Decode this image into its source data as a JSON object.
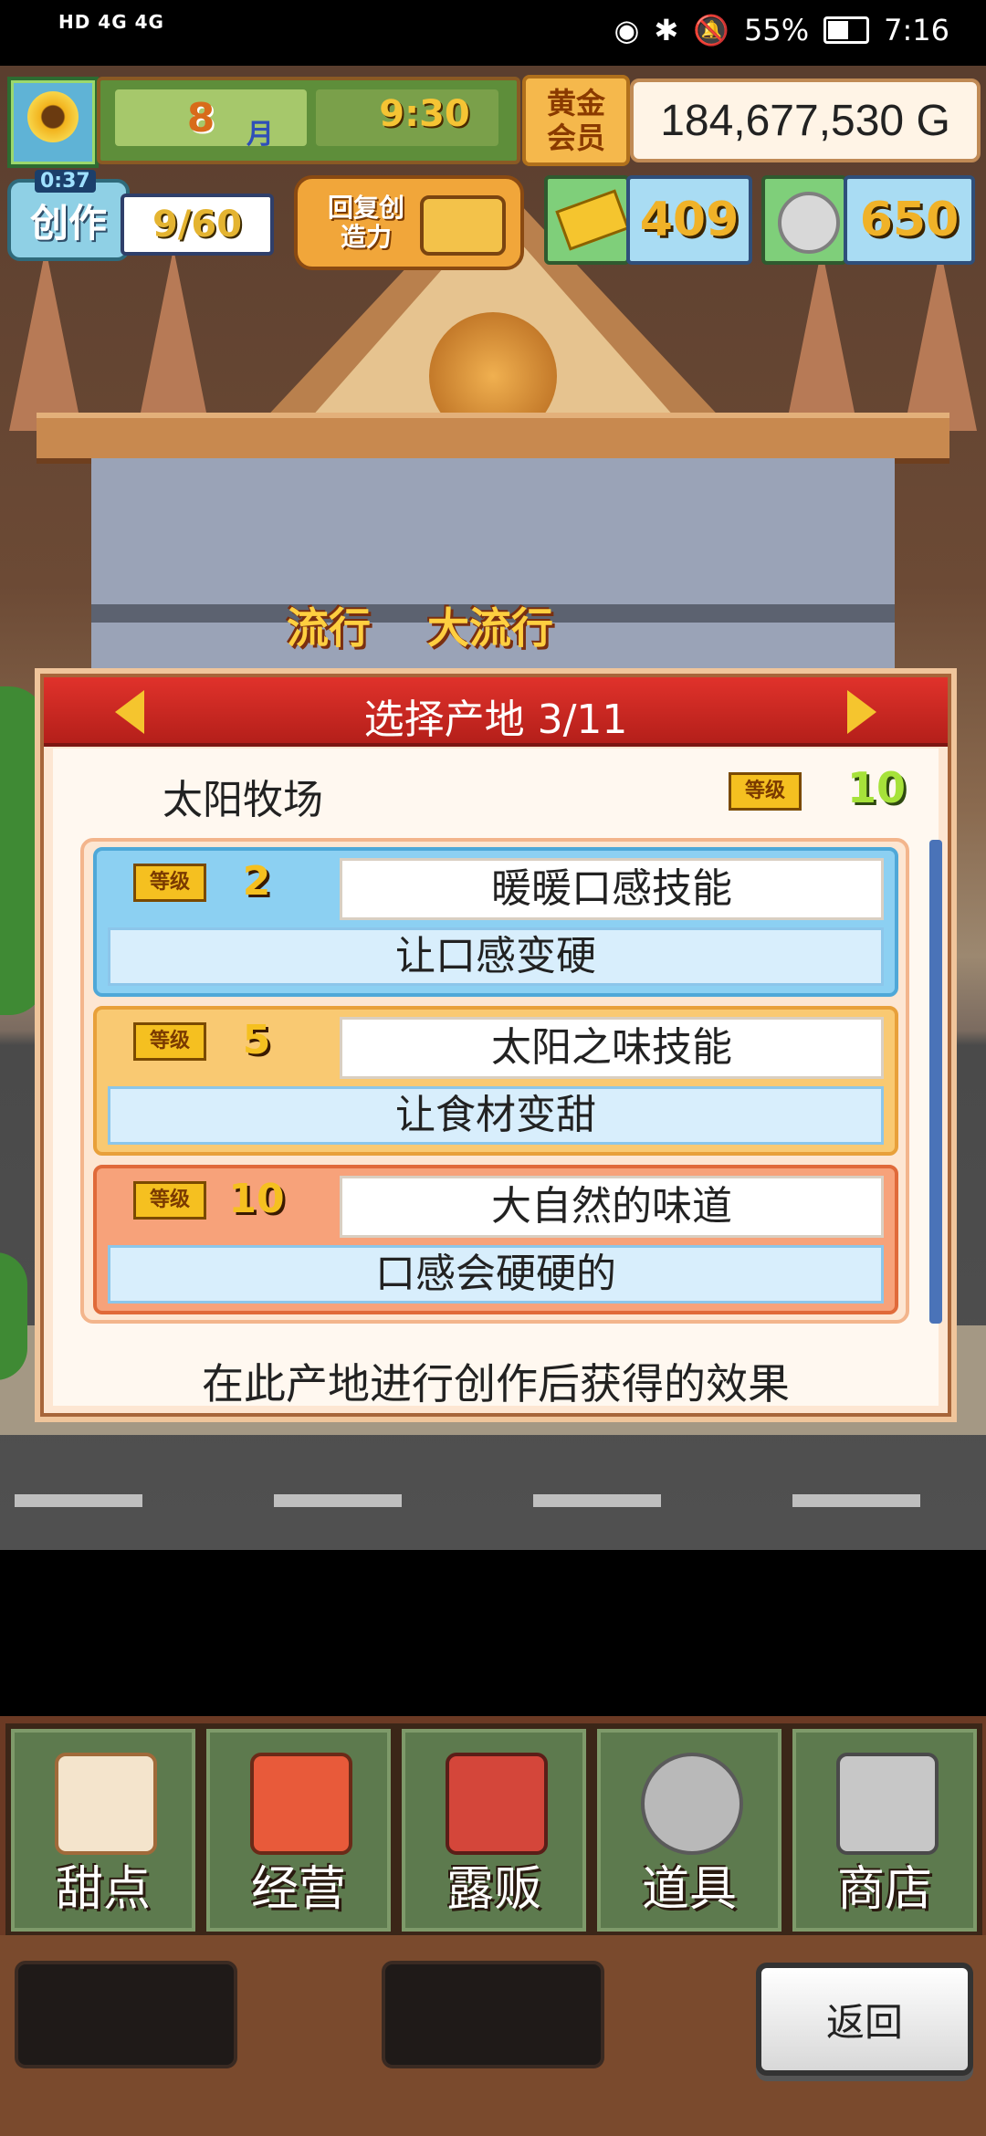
{
  "status_bar": {
    "network": "HD 4G 4G",
    "battery": "55%",
    "time": "7:16"
  },
  "hud": {
    "month_number": "8",
    "month_label": "月",
    "time": "9:30",
    "gold_member_label": "黄金会员",
    "money": "184,677,530 G",
    "create_label": "创作",
    "create_small": "0:37",
    "create_count": "9/60",
    "restore_label": "回复创造力",
    "tickets": "409",
    "coins": "650"
  },
  "scene": {
    "trend_label": "流行",
    "big_trend_label": "大流行"
  },
  "dialog": {
    "title": "选择产地 3/11",
    "farm_name": "太阳牧场",
    "level_tag": "等级",
    "farm_level": "10",
    "skills": [
      {
        "level": "2",
        "name": "暖暖口感技能",
        "effect": "让口感变硬"
      },
      {
        "level": "5",
        "name": "太阳之味技能",
        "effect": "让食材变甜"
      },
      {
        "level": "10",
        "name": "大自然的味道",
        "effect": "口感会硬硬的"
      }
    ],
    "footer": "在此产地进行创作后获得的效果"
  },
  "menu": {
    "items": [
      {
        "label": "甜点",
        "icon": "cake-icon"
      },
      {
        "label": "经营",
        "icon": "shop-icon"
      },
      {
        "label": "露贩",
        "icon": "food-truck-icon"
      },
      {
        "label": "道具",
        "icon": "gear-bag-icon"
      },
      {
        "label": "商店",
        "icon": "cart-icon"
      }
    ],
    "back_label": "返回"
  },
  "colors": {
    "dialog_header": "#c4241e",
    "skill_blue": "#8cd0f2",
    "skill_yellow": "#f9c972",
    "skill_orange": "#f7a27a",
    "gold": "#f5c020"
  }
}
